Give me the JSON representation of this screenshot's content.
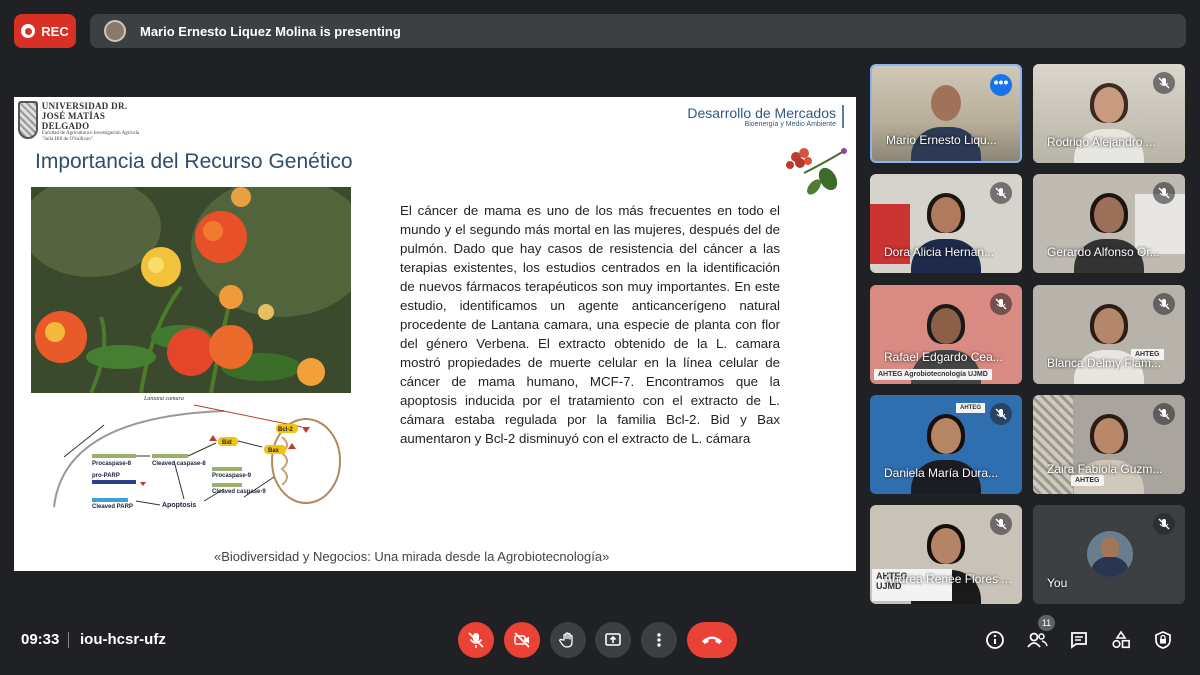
{
  "top_bar": {
    "rec_label": "REC",
    "presenter_text": "Mario Ernesto Liquez Molina is presenting"
  },
  "slide": {
    "university_name": "UNIVERSIDAD DR. JOSÉ MATÍAS DELGADO",
    "university_sub": "Facultad de Agricultura e Investigación Agrícola \"Julia Hill de O'Sullivan\"",
    "dept_title": "Desarrollo de Mercados",
    "dept_sub": "Bioenergía y Medio Ambiente",
    "title": "Importancia del Recurso Genético",
    "photo_caption": "Lantana camara",
    "diagram": {
      "procaspase8": "Procaspase-8",
      "cleaved_caspase8": "Cleaved caspase-8",
      "bid": "Bid",
      "bax": "Bax",
      "bcl2": "Bcl-2",
      "pro_parp": "pro-PARP",
      "procaspase9": "Procaspase-9",
      "cleaved_caspase9": "Cleaved caspase-9",
      "cleaved_parp": "Cleaved PARP",
      "apoptosis": "Apoptosis"
    },
    "body_text": "El cáncer de mama es uno de los más frecuentes en todo el mundo y el segundo más mortal en las mujeres, después del de pulmón. Dado que hay casos de resistencia del cáncer a las terapias existentes, los estudios centrados en la identificación de nuevos fármacos terapéuticos son muy importantes. En este estudio, identificamos un agente anticancerígeno natural procedente de Lantana camara, una especie de planta con flor del género Verbena. El extracto obtenido de la L. camara mostró propiedades de muerte celular en la línea celular de cáncer de mama humano, MCF-7. Encontramos que la apoptosis inducida por el tratamiento con el extracto de L. cámara estaba regulada por la familia Bcl-2. Bid y Bax aumentaron y Bcl-2 disminuyó con el extracto de L. cámara",
    "footer": "«Biodiversidad y Negocios: Una mirada desde la Agrobiotecnología»"
  },
  "participants": [
    {
      "name": "Mario Ernesto Liqu...",
      "muted": false
    },
    {
      "name": "Rodrigo Alejandro ...",
      "muted": true
    },
    {
      "name": "Dora Alicia Hernan...",
      "muted": true
    },
    {
      "name": "Gerardo Alfonso Or...",
      "muted": true
    },
    {
      "name": "Rafael Edgardo Cea...",
      "muted": true
    },
    {
      "name": "Blanca Delmy Flam...",
      "muted": true
    },
    {
      "name": "Daniela María Dura...",
      "muted": true
    },
    {
      "name": "Zaira Fabiola Guzm...",
      "muted": true
    },
    {
      "name": "Andrea Renee Flores ...",
      "muted": true
    },
    {
      "name": "You",
      "muted": true
    }
  ],
  "signs": {
    "ahteg": "AHTEG",
    "ahteg_long": "AHTEG Agrobiotecnología UJMD",
    "ujmd": "UJMD"
  },
  "bottom_bar": {
    "time": "09:33",
    "meeting_code": "iou-hcsr-ufz",
    "participant_count": "11"
  },
  "colors": {
    "background": "#202124",
    "accent_red": "#ea4335",
    "presenter_border": "#8ab4f8",
    "button_gray": "#3c4043"
  }
}
